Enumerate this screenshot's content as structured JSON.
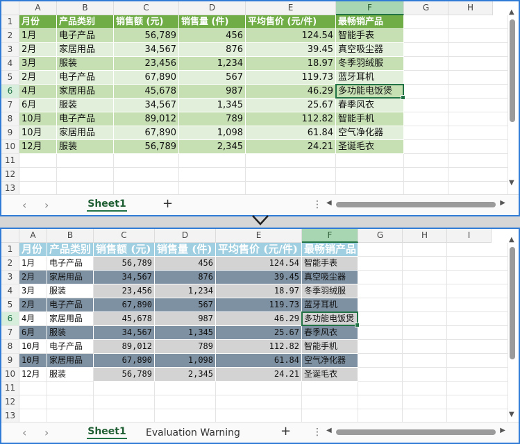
{
  "columns": [
    "A",
    "B",
    "C",
    "D",
    "E",
    "F",
    "G",
    "H",
    "I"
  ],
  "rows": [
    "1",
    "2",
    "3",
    "4",
    "5",
    "6",
    "7",
    "8",
    "9",
    "10",
    "11",
    "12",
    "13"
  ],
  "table": {
    "headers": [
      "月份",
      "产品类别",
      "销售额 (元)",
      "销售量 (件)",
      "平均售价 (元/件)",
      "最畅销产品"
    ],
    "rows": [
      [
        "1月",
        "电子产品",
        "56,789",
        "456",
        "124.54",
        "智能手表"
      ],
      [
        "2月",
        "家居用品",
        "34,567",
        "876",
        "39.45",
        "真空吸尘器"
      ],
      [
        "3月",
        "服装",
        "23,456",
        "1,234",
        "18.97",
        "冬季羽绒服"
      ],
      [
        "2月",
        "电子产品",
        "67,890",
        "567",
        "119.73",
        "蓝牙耳机"
      ],
      [
        "4月",
        "家居用品",
        "45,678",
        "987",
        "46.29",
        "多功能电饭煲"
      ],
      [
        "6月",
        "服装",
        "34,567",
        "1,345",
        "25.67",
        "春季风衣"
      ],
      [
        "10月",
        "电子产品",
        "89,012",
        "789",
        "112.82",
        "智能手机"
      ],
      [
        "10月",
        "家居用品",
        "67,890",
        "1,098",
        "61.84",
        "空气净化器"
      ],
      [
        "12月",
        "服装",
        "56,789",
        "2,345",
        "24.21",
        "圣诞毛衣"
      ]
    ]
  },
  "top_window": {
    "tabs": [
      "Sheet1"
    ],
    "active_tab": "Sheet1",
    "header_fill": "#70ad47",
    "band_fills": [
      "#c6e0b4",
      "#e2efda"
    ]
  },
  "bottom_window": {
    "tabs": [
      "Sheet1",
      "Evaluation Warning"
    ],
    "active_tab": "Sheet1",
    "header_fill": "#9fcfe0",
    "band_fills": [
      "#d3d3d3",
      "#7e91a3"
    ]
  },
  "selection": {
    "row": "6",
    "column": "F"
  },
  "icons": {
    "prev": "chevron-left-icon",
    "next": "chevron-right-icon",
    "add": "plus-icon",
    "more": "vertical-ellipsis-icon",
    "divider": "chevron-down-icon"
  },
  "glyphs": {
    "prev": "‹",
    "next": "›",
    "add": "+",
    "more": "⋮",
    "scroll_left": "◀",
    "scroll_right": "▶",
    "scroll_up": "▲",
    "scroll_down": "▼"
  }
}
